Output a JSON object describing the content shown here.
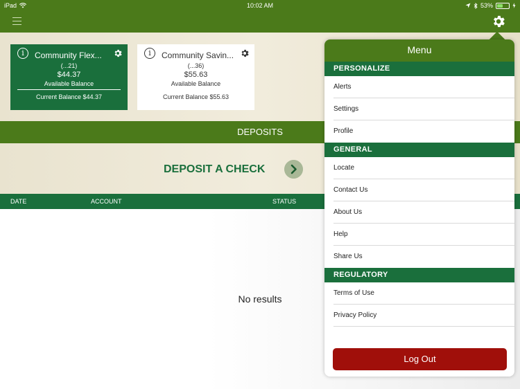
{
  "status_bar": {
    "device": "iPad",
    "time": "10:02 AM",
    "battery": "53%",
    "battery_level": 0.53
  },
  "cards": [
    {
      "name": "Community Flex...",
      "number": "(...21)",
      "balance": "$44.37",
      "balance_label": "Available Balance",
      "current": "Current Balance $44.37"
    },
    {
      "name": "Community Savin...",
      "number": "(...36)",
      "balance": "$55.63",
      "balance_label": "Available Balance",
      "current": "Current Balance $55.63"
    }
  ],
  "deposits": {
    "bar_title": "DEPOSITS",
    "deposit_check": "DEPOSIT A CHECK"
  },
  "table": {
    "columns": [
      "DATE",
      "ACCOUNT",
      "STATUS"
    ],
    "empty_text": "No results"
  },
  "menu": {
    "title": "Menu",
    "sections": [
      {
        "title": "PERSONALIZE",
        "items": [
          "Alerts",
          "Settings",
          "Profile"
        ]
      },
      {
        "title": "GENERAL",
        "items": [
          "Locate",
          "Contact Us",
          "About Us",
          "Help",
          "Share Us"
        ]
      },
      {
        "title": "REGULATORY",
        "items": [
          "Terms of Use",
          "Privacy Policy"
        ]
      }
    ],
    "logout": "Log Out"
  },
  "colors": {
    "nav_green": "#4b7a1a",
    "dark_green": "#1a6f3c",
    "logout_red": "#a00f0a"
  }
}
